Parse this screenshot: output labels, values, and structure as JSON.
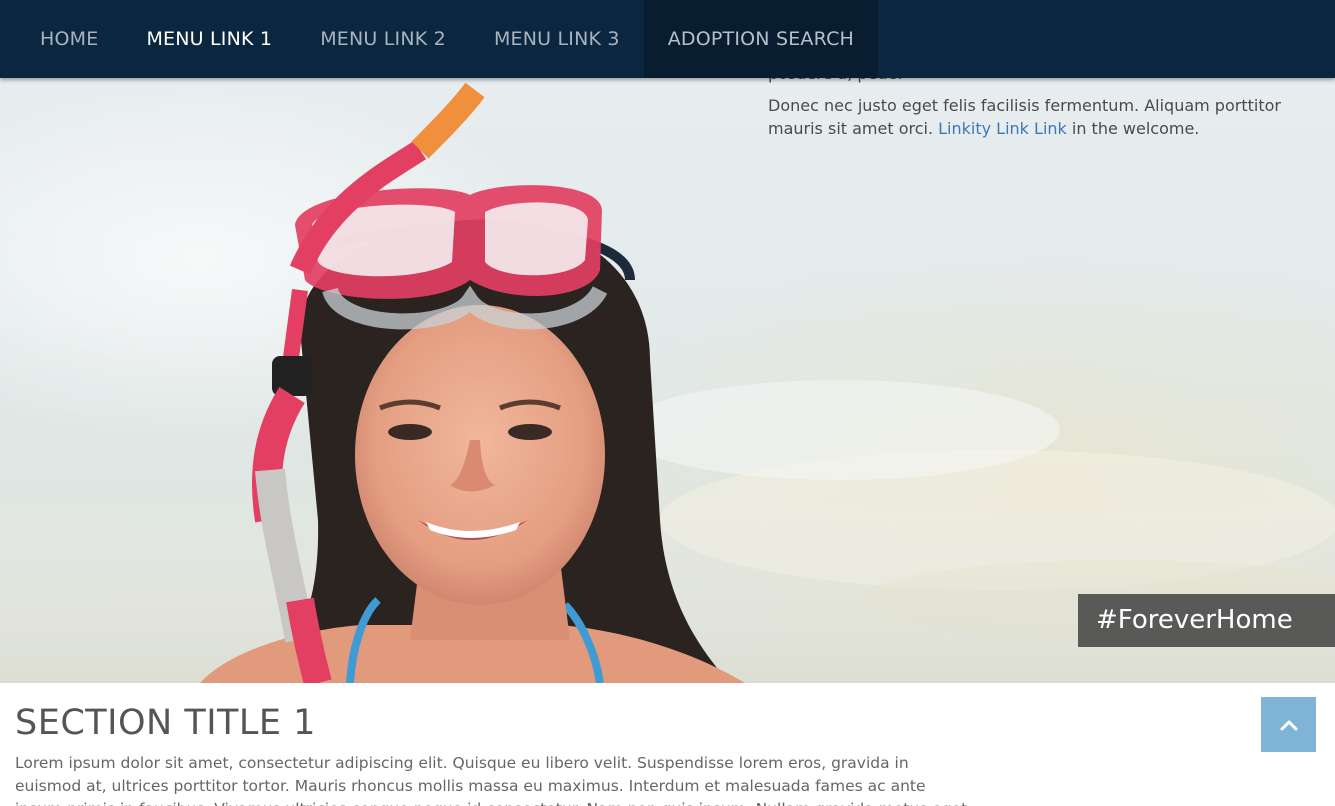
{
  "nav": {
    "items": [
      {
        "label": "HOME"
      },
      {
        "label": "MENU LINK 1"
      },
      {
        "label": "MENU LINK 2"
      },
      {
        "label": "MENU LINK 3"
      },
      {
        "label": "ADOPTION SEARCH"
      }
    ],
    "active_index": 1
  },
  "welcome": {
    "para1_tail": "posuere a, pede.",
    "para2_before_link": "Donec nec justo eget felis facilisis fermentum. Aliquam porttitor mauris sit amet orci. ",
    "link_text": "Linkity Link Link",
    "para2_after_link": " in the welcome."
  },
  "hero": {
    "hashtag": "#ForeverHome"
  },
  "section": {
    "title": "SECTION TITLE 1",
    "body": "Lorem ipsum dolor sit amet, consectetur adipiscing elit. Quisque eu libero velit. Suspendisse lorem eros, gravida in euismod at, ultrices porttitor tortor. Mauris rhoncus mollis massa eu maximus. Interdum et malesuada fames ac ante ipsum primis in faucibus. Vivamus ultricies congue neque id consectetur. Nam non quis ipsum. Nullam gravida metus eget leo mattis tempor. Mauris mi eleifend."
  },
  "colors": {
    "nav_bg": "#0b2740",
    "nav_active": "#ffffff",
    "link": "#3b78b5",
    "back_to_top": "#7fb4d6",
    "hashtag_bg": "#464646"
  },
  "icons": {
    "back_to_top": "chevron-up-icon"
  }
}
